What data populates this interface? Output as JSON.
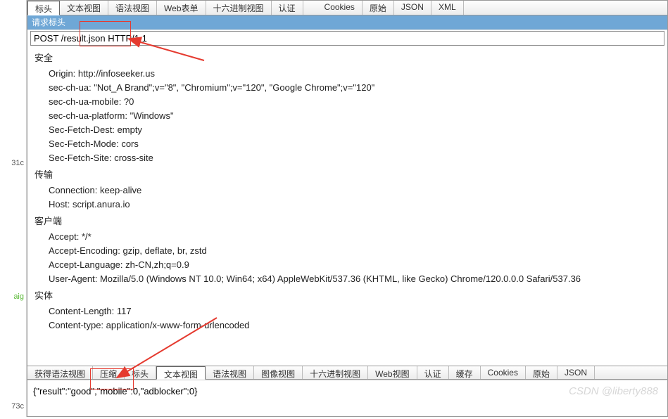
{
  "leftStrip": {
    "l1": "31c",
    "l2": "aig",
    "l3": "73c"
  },
  "topTabs": [
    "标头",
    "文本视图",
    "语法视图",
    "Web表单",
    "十六进制视图",
    "认证",
    "Cookies",
    "原始",
    "JSON",
    "XML"
  ],
  "topActiveIndex": 0,
  "blueHeader": "请求标头",
  "requestLine": "POST /result.json HTTP/1.1",
  "sections": [
    {
      "title": "安全",
      "items": [
        "Origin: http://infoseeker.us",
        "sec-ch-ua: \"Not_A Brand\";v=\"8\", \"Chromium\";v=\"120\", \"Google Chrome\";v=\"120\"",
        "sec-ch-ua-mobile: ?0",
        "sec-ch-ua-platform: \"Windows\"",
        "Sec-Fetch-Dest: empty",
        "Sec-Fetch-Mode: cors",
        "Sec-Fetch-Site: cross-site"
      ]
    },
    {
      "title": "传输",
      "items": [
        "Connection: keep-alive",
        "Host: script.anura.io"
      ]
    },
    {
      "title": "客户端",
      "items": [
        "Accept: */*",
        "Accept-Encoding: gzip, deflate, br, zstd",
        "Accept-Language: zh-CN,zh;q=0.9",
        "User-Agent: Mozilla/5.0 (Windows NT 10.0; Win64; x64) AppleWebKit/537.36 (KHTML, like Gecko) Chrome/120.0.0.0 Safari/537.36"
      ]
    },
    {
      "title": "实体",
      "items": [
        "Content-Length: 117",
        "Content-type: application/x-www-form-urlencoded"
      ]
    }
  ],
  "bottomTabs": [
    "获得语法视图",
    "压缩",
    "标头",
    "文本视图",
    "语法视图",
    "图像视图",
    "十六进制视图",
    "Web视图",
    "认证",
    "缓存",
    "Cookies",
    "原始",
    "JSON"
  ],
  "bottomActiveIndex": 3,
  "responseBody": "{\"result\":\"good\",\"mobile\":0,\"adblocker\":0}",
  "watermark": "CSDN @liberty888"
}
